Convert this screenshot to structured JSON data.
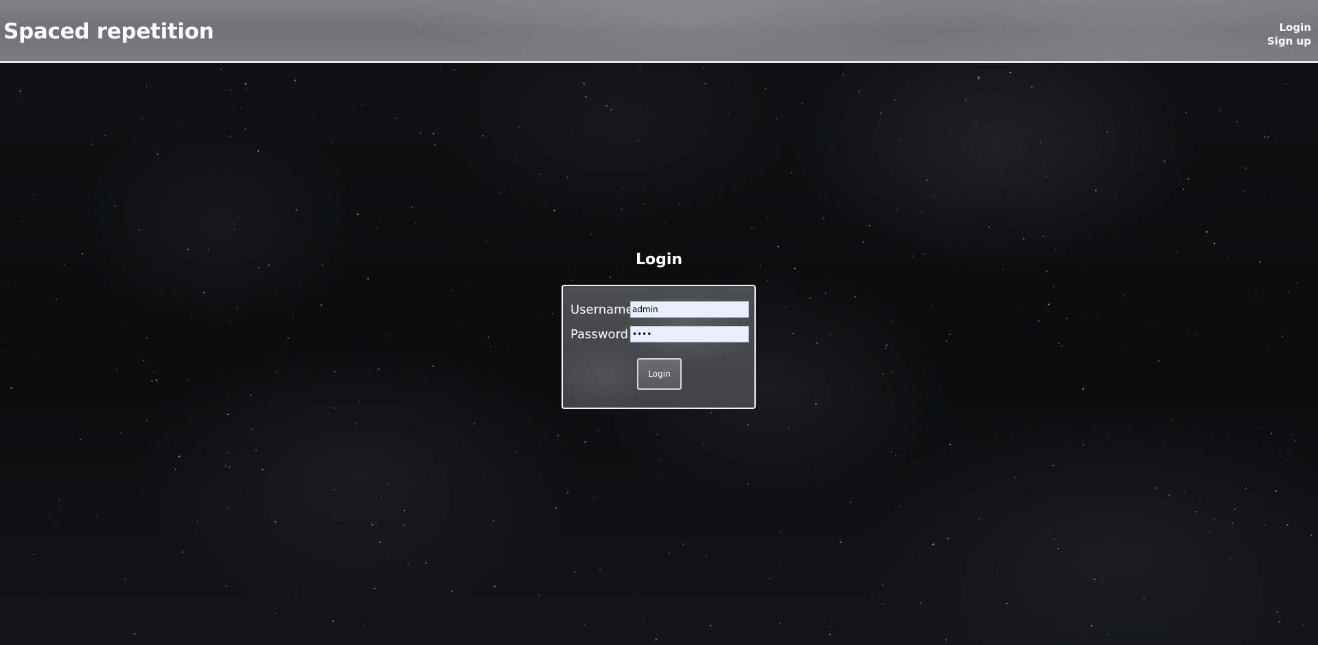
{
  "header": {
    "site_title": "Spaced repetition",
    "nav": {
      "login_label": "Login",
      "signup_label": "Sign up"
    }
  },
  "main": {
    "heading": "Login",
    "form": {
      "username_label": "Username",
      "username_value": "admin",
      "password_label": "Password",
      "password_value": "••••",
      "submit_label": "Login"
    }
  }
}
